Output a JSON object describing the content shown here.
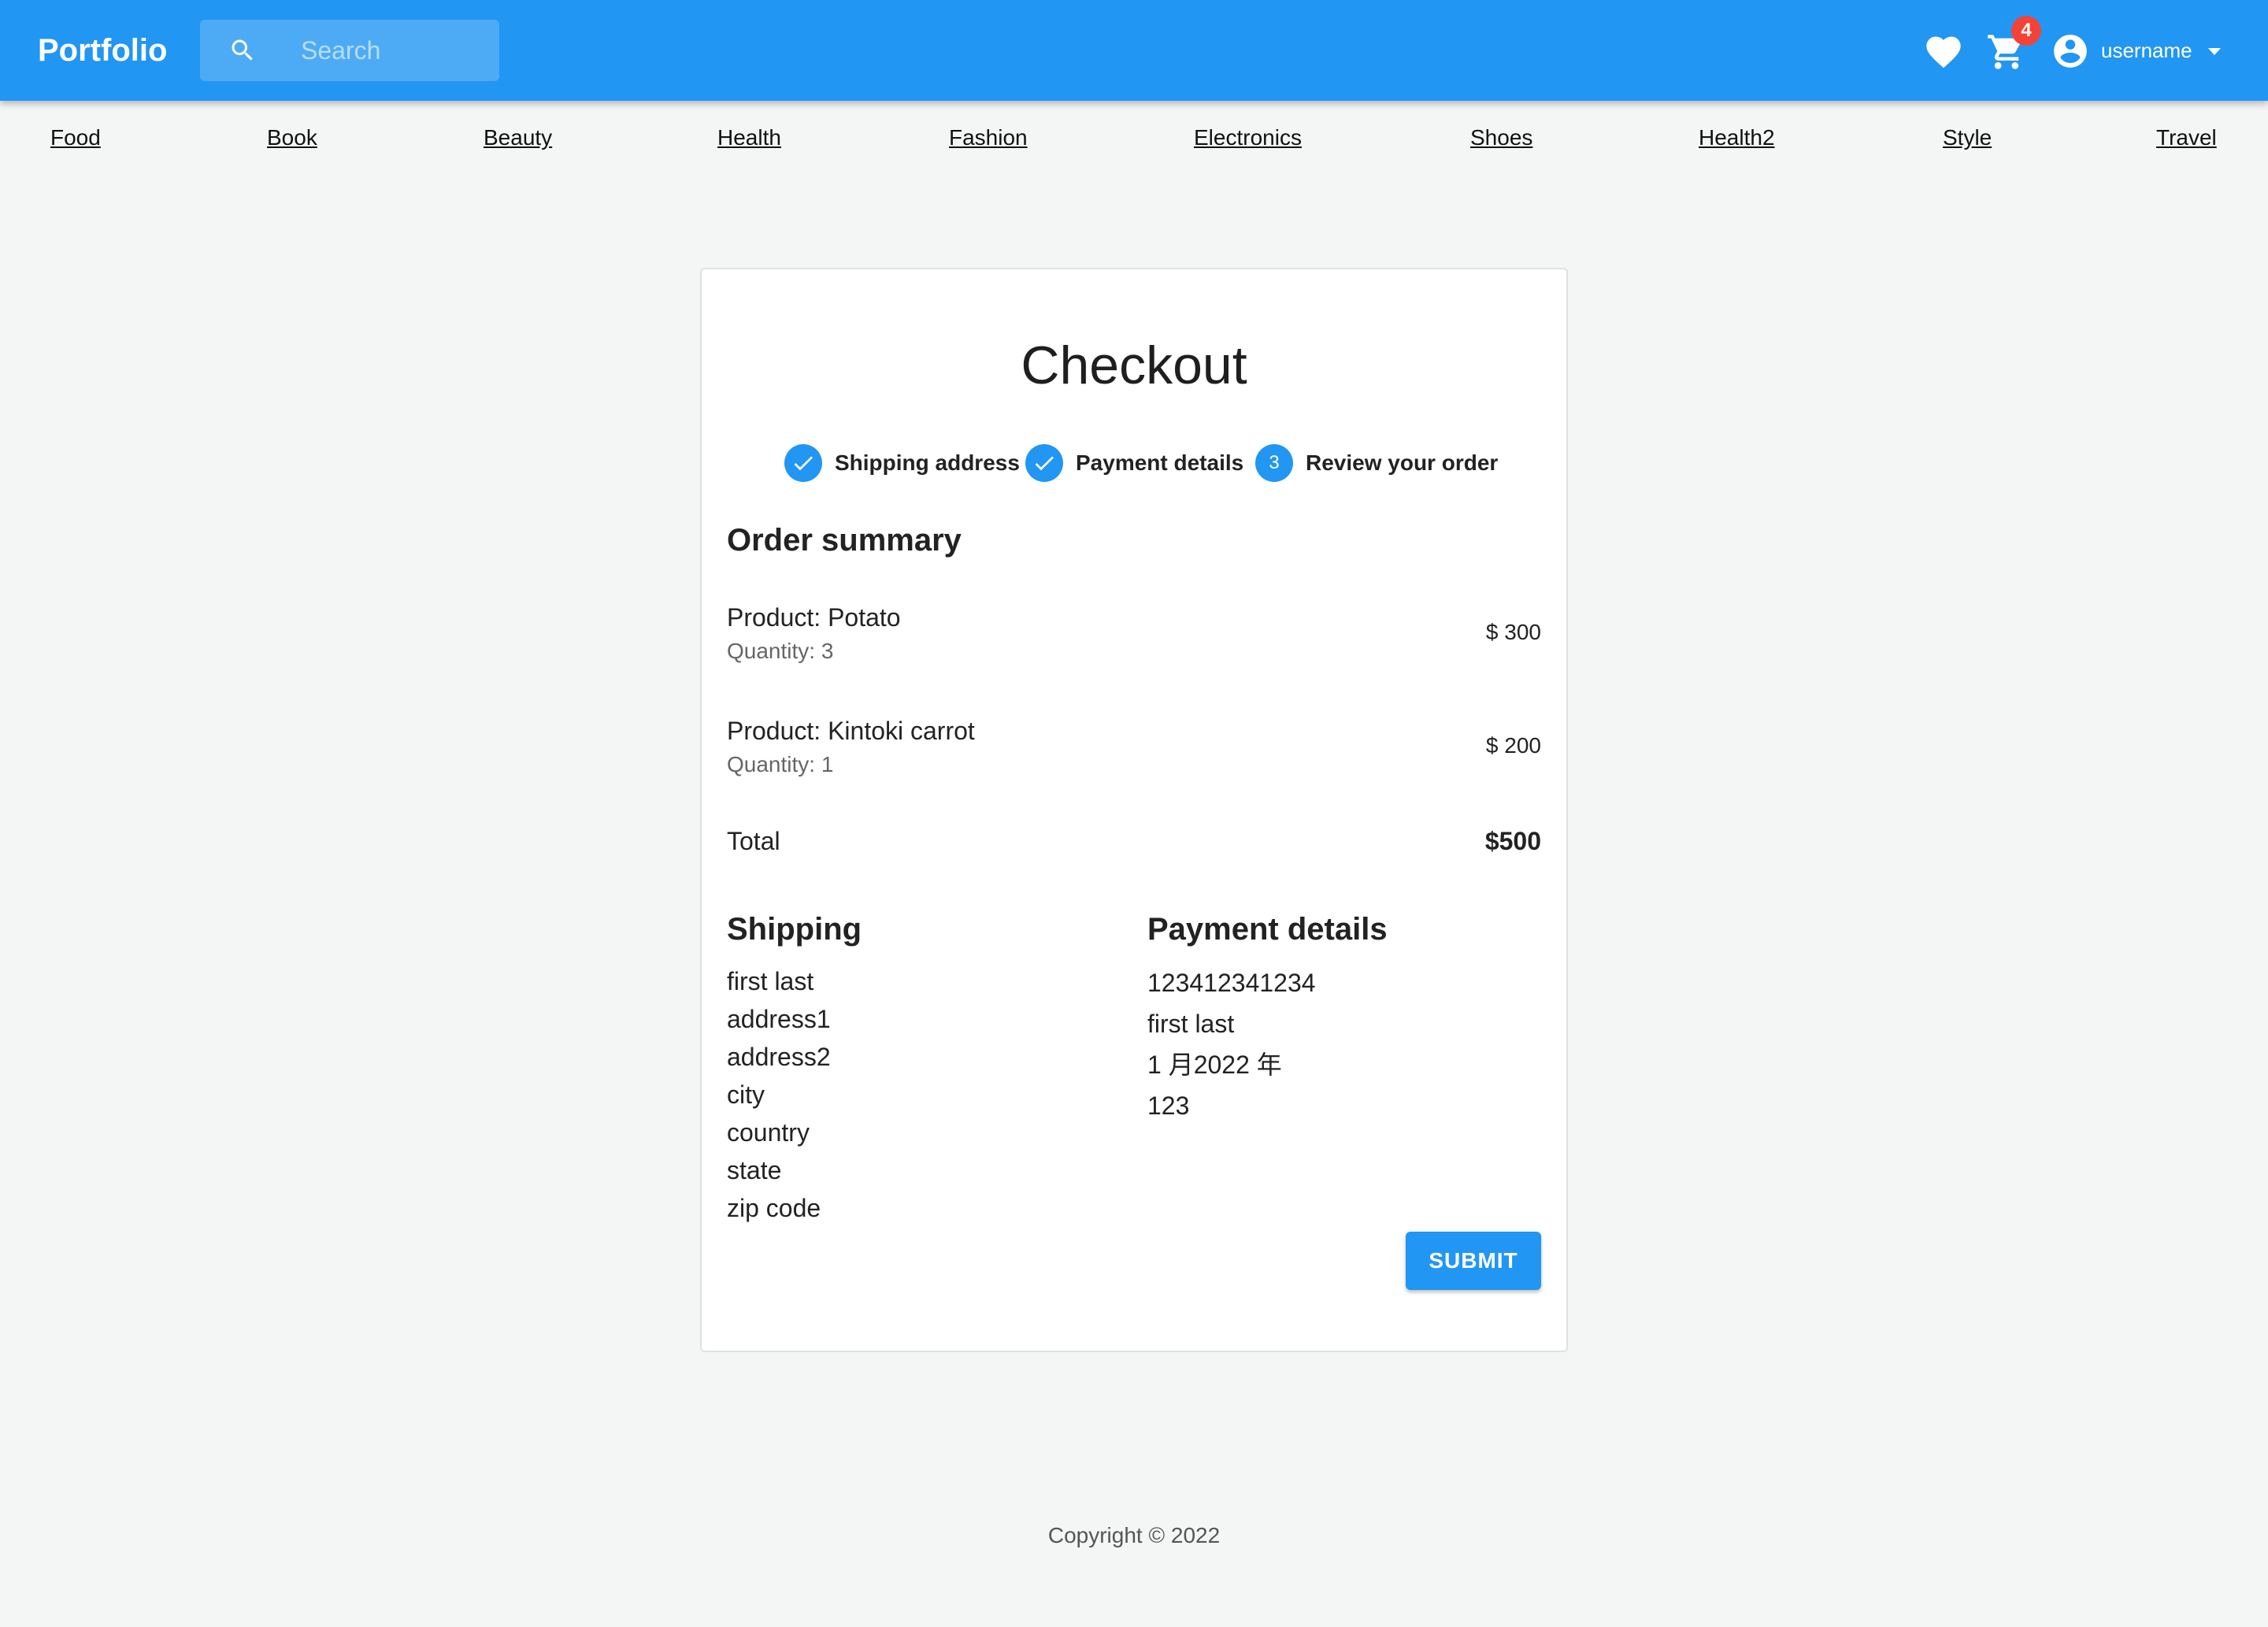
{
  "header": {
    "brand": "Portfolio",
    "search_placeholder": "Search",
    "cart_count": "4",
    "username": "username",
    "accent_color": "#2196f3"
  },
  "categories": [
    "Food",
    "Book",
    "Beauty",
    "Health",
    "Fashion",
    "Electronics",
    "Shoes",
    "Health2",
    "Style",
    "Travel"
  ],
  "checkout": {
    "title": "Checkout",
    "steps": [
      {
        "label": "Shipping address",
        "status": "completed",
        "icon": "check-icon"
      },
      {
        "label": "Payment details",
        "status": "completed",
        "icon": "check-icon"
      },
      {
        "label": "Review your order",
        "status": "active",
        "number": "3"
      }
    ],
    "order_summary_heading": "Order summary",
    "products": [
      {
        "name": "Product: Potato",
        "quantity": "Quantity: 3",
        "price": "$ 300"
      },
      {
        "name": "Product: Kintoki carrot",
        "quantity": "Quantity: 1",
        "price": "$ 200"
      }
    ],
    "total_label": "Total",
    "total_value": "$500",
    "shipping_heading": "Shipping",
    "shipping": [
      "first last",
      "address1",
      "address2",
      "city",
      "country",
      "state",
      "zip code"
    ],
    "payment_heading": "Payment details",
    "payment": [
      "123412341234",
      "first last",
      "1 月2022 年",
      "123"
    ],
    "submit_label": "SUBMIT"
  },
  "footer": {
    "copyright": "Copyright © 2022"
  }
}
